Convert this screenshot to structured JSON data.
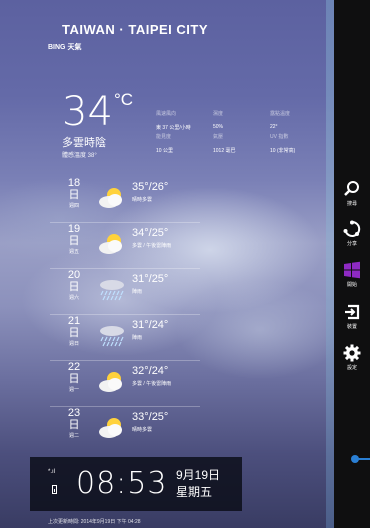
{
  "location": {
    "city": "TAIWAN · TAIPEI CITY",
    "source": "BING 天氣"
  },
  "current": {
    "temp": "34",
    "unit": "°C",
    "condition": "多雲時陰",
    "feels_like": "體感溫度 38°",
    "details": [
      {
        "label": "風速風向",
        "value": "東 37 公里/小時"
      },
      {
        "label": "濕度",
        "value": "50%"
      },
      {
        "label": "露點溫度",
        "value": "22°"
      },
      {
        "label": "能見度",
        "value": "10 公里"
      },
      {
        "label": "氣壓",
        "value": "1012 毫巴"
      },
      {
        "label": "UV 指數",
        "value": "10 (非常高)"
      }
    ]
  },
  "forecast": [
    {
      "day_num": "18",
      "day_char": "日",
      "weekday": "週四",
      "icon": "partly-cloudy-icon",
      "hilo": "35°/26°",
      "cond": "晴時多雲"
    },
    {
      "day_num": "19",
      "day_char": "日",
      "weekday": "週五",
      "icon": "partly-cloudy-icon",
      "hilo": "34°/25°",
      "cond": "多雲 / 午後雷陣雨"
    },
    {
      "day_num": "20",
      "day_char": "日",
      "weekday": "週六",
      "icon": "rain-icon",
      "hilo": "31°/25°",
      "cond": "陣雨"
    },
    {
      "day_num": "21",
      "day_char": "日",
      "weekday": "週日",
      "icon": "rain-icon",
      "hilo": "31°/24°",
      "cond": "陣雨"
    },
    {
      "day_num": "22",
      "day_char": "日",
      "weekday": "週一",
      "icon": "partly-cloudy-icon",
      "hilo": "32°/24°",
      "cond": "多雲 / 午後雷陣雨"
    },
    {
      "day_num": "23",
      "day_char": "日",
      "weekday": "週二",
      "icon": "partly-cloudy-icon",
      "hilo": "33°/25°",
      "cond": "晴時多雲"
    }
  ],
  "clock": {
    "time": "08:53",
    "date": "9月19日",
    "day": "星期五"
  },
  "updated": "上次更新時間: 2014年9月19日 下午 04:28",
  "charms": [
    {
      "label": "搜尋",
      "icon": "search-icon"
    },
    {
      "label": "分享",
      "icon": "share-icon"
    },
    {
      "label": "開始",
      "icon": "windows-start-icon"
    },
    {
      "label": "裝置",
      "icon": "devices-icon"
    },
    {
      "label": "設定",
      "icon": "gear-icon"
    }
  ],
  "colors": {
    "charm_bar": "#0f0f10",
    "start_accent": "#8e2ac4",
    "scroll_accent": "#2a7fd4"
  }
}
